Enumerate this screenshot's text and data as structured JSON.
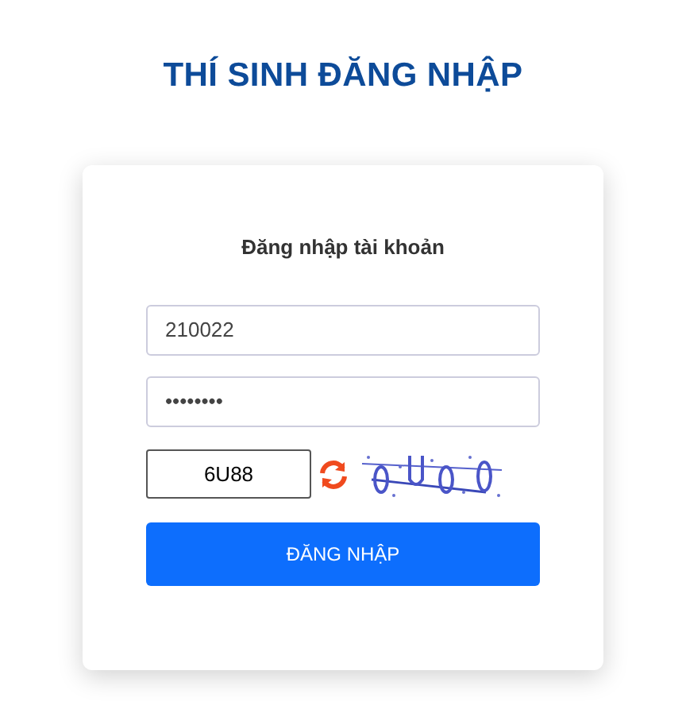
{
  "page_title": "THÍ SINH ĐĂNG NHẬP",
  "login_card": {
    "heading": "Đăng nhập tài khoản",
    "username": {
      "value": "210022"
    },
    "password": {
      "value": "••••••••"
    },
    "captcha": {
      "value": "6U88"
    },
    "submit_button": "ĐĂNG NHẬP"
  }
}
